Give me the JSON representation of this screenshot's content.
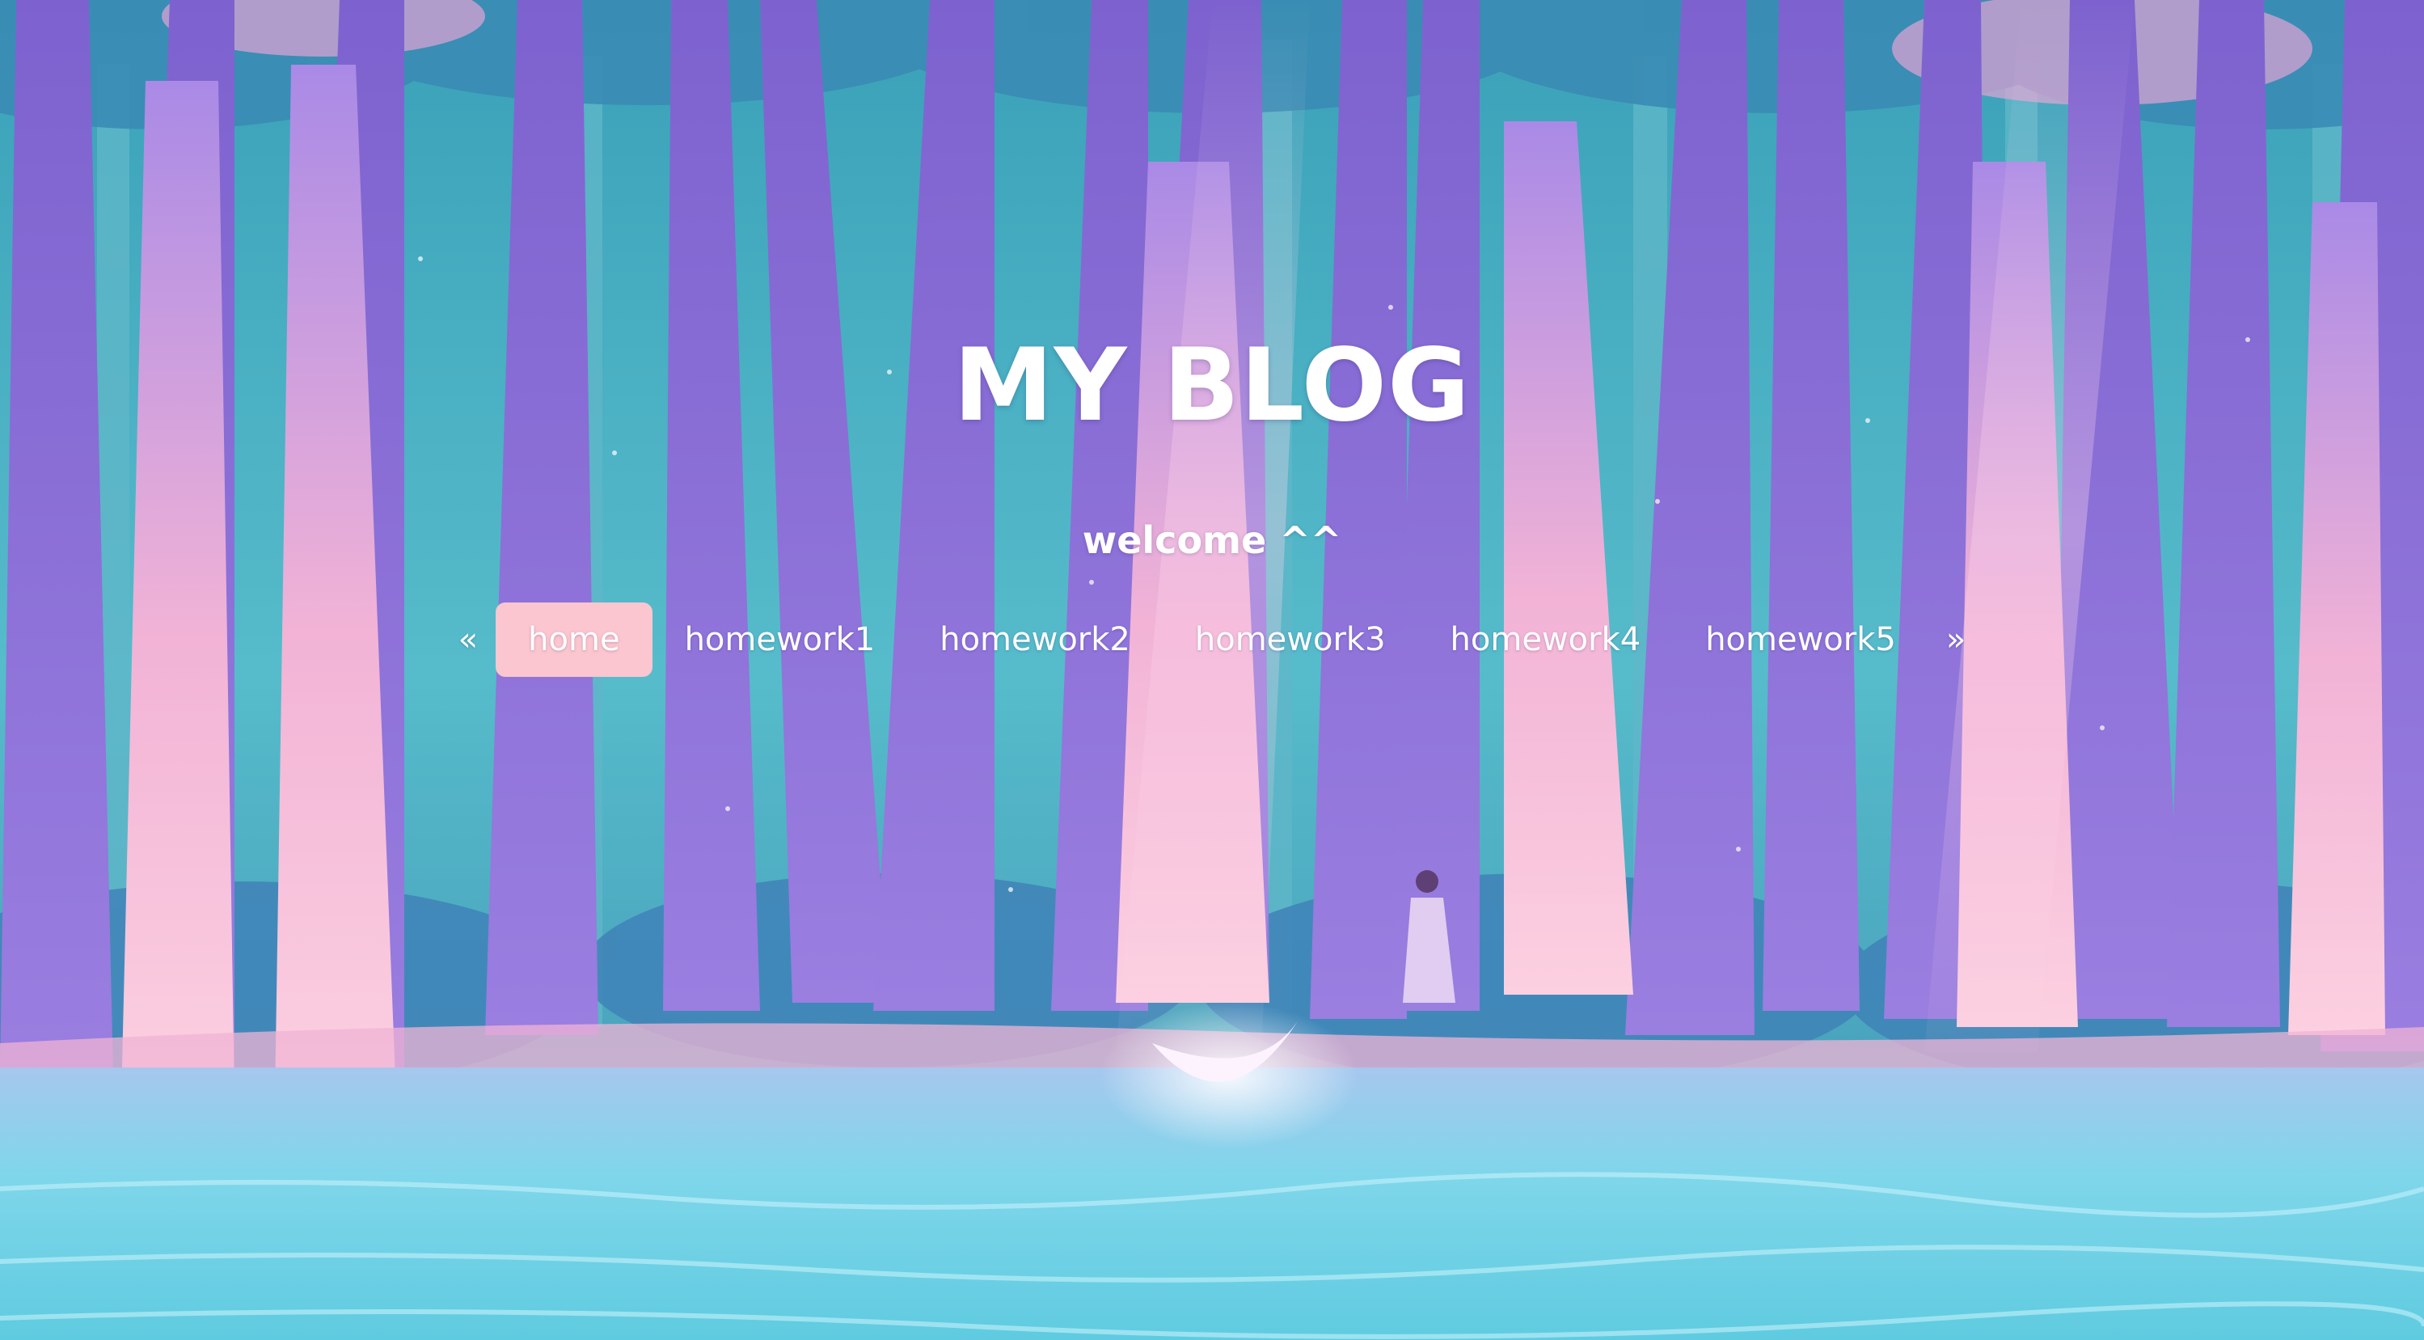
{
  "page": {
    "title": "MY BLOG",
    "subtitle": "welcome ^^"
  },
  "nav": {
    "prev_label": "«",
    "next_label": "»",
    "items": [
      {
        "label": "home",
        "active": true
      },
      {
        "label": "homework1",
        "active": false
      },
      {
        "label": "homework2",
        "active": false
      },
      {
        "label": "homework3",
        "active": false
      },
      {
        "label": "homework4",
        "active": false
      },
      {
        "label": "homework5",
        "active": false
      }
    ],
    "active_color": "#fbc6cf"
  },
  "background": {
    "icon": "forest-lake-illustration",
    "sky_color": "#4bb2c6",
    "water_color": "#9ee3f3",
    "tree_color": "#8a6fd6",
    "glow_color": "#f6b8d8"
  }
}
